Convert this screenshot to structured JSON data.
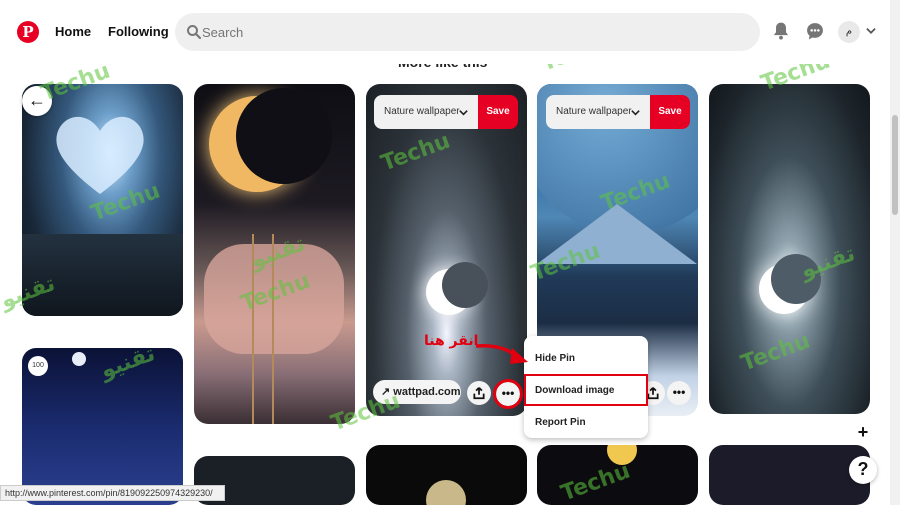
{
  "header": {
    "logo_letter": "P",
    "nav_home": "Home",
    "nav_following": "Following",
    "search_placeholder": "Search",
    "avatar_letter": "م"
  },
  "section_title": "More like this",
  "pins": {
    "board_label_1": "Nature wallpaper",
    "save_label_1": "Save",
    "board_label_2": "Nature wallpaper",
    "save_label_2": "Save",
    "source_label": "wattpad.com",
    "more_label": "•••",
    "badge": "100"
  },
  "menu": {
    "hide": "Hide Pin",
    "download": "Download image",
    "report": "Report Pin"
  },
  "annotation": "انقر هنا",
  "status_url": "http://www.pinterest.com/pin/819092250974329230/",
  "buttons": {
    "back": "←",
    "add": "+",
    "help": "?"
  },
  "watermark": {
    "latin": "Techu",
    "arabic": "تقنيو"
  },
  "colors": {
    "brand_red": "#e60023",
    "highlight_red": "#e0000f",
    "watermark_green": "#5cc43c"
  }
}
